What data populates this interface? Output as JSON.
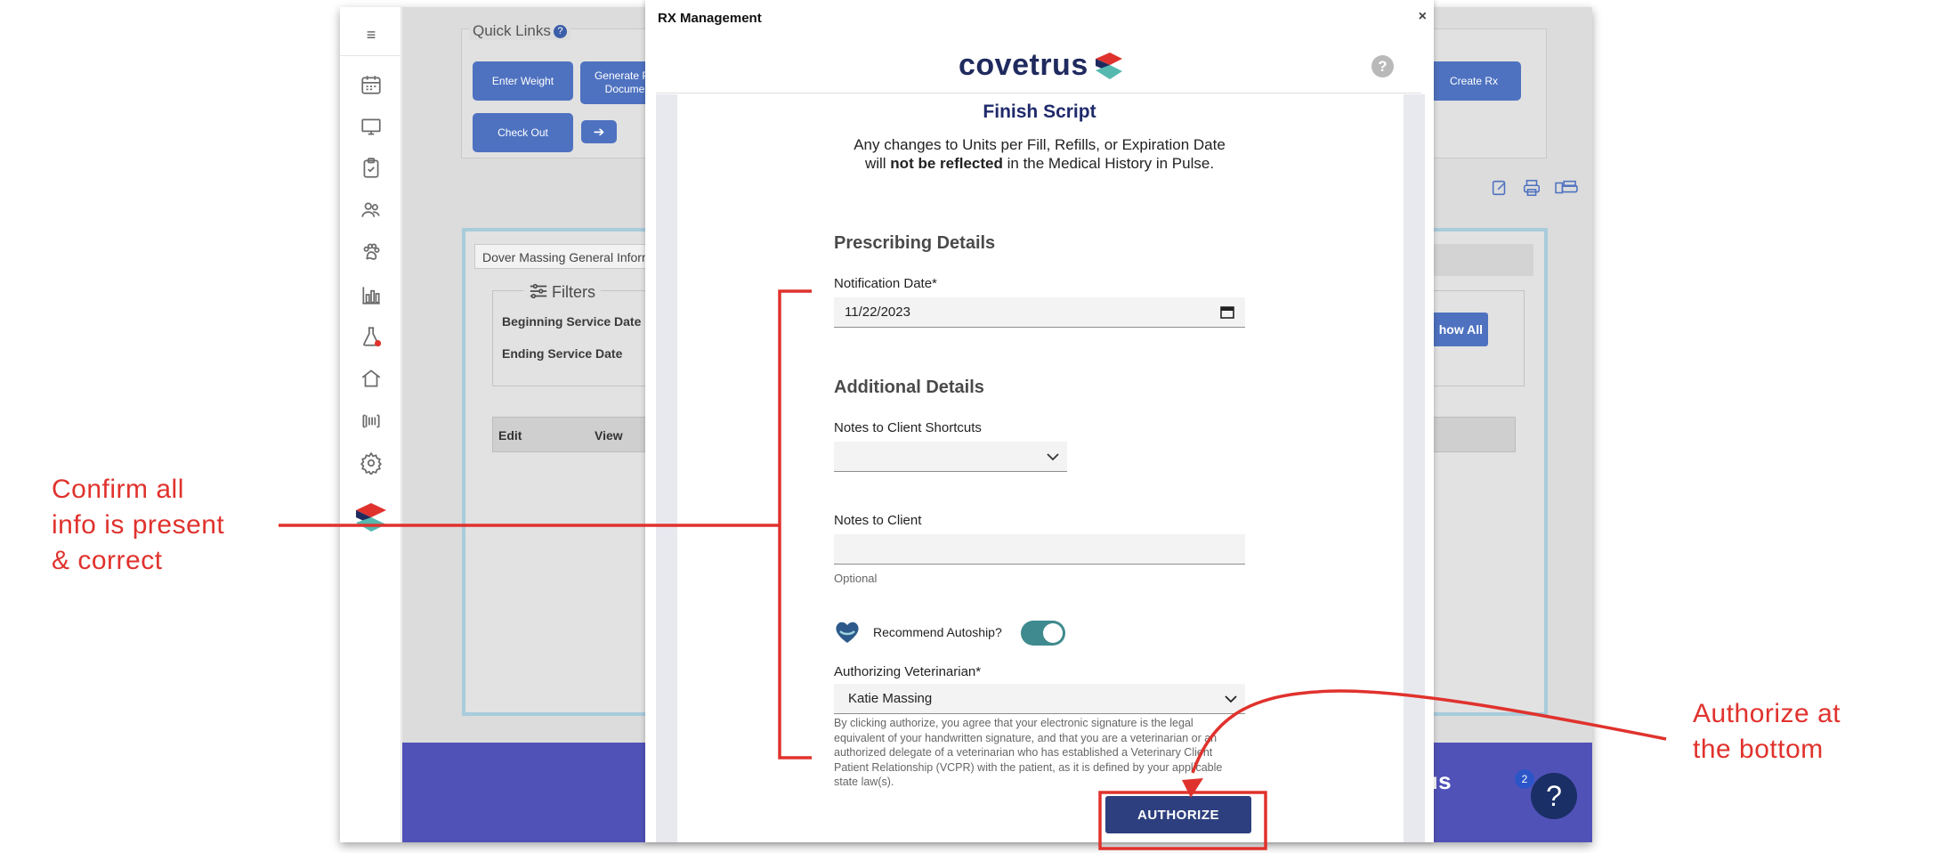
{
  "app": {
    "quick_links": {
      "title": "Quick Links",
      "buttons": {
        "enter_weight": "Enter Weight",
        "generate_docs_line1": "Generate Pa",
        "generate_docs_line2": "Docume",
        "check_out": "Check Out",
        "create_rx": "Create Rx"
      }
    },
    "panel": {
      "tab_label": "Dover Massing General Inform",
      "filters_title": "Filters",
      "beginning_service_date": "Beginning Service Date",
      "ending_service_date": "Ending Service Date",
      "show_all": "how All",
      "columns": [
        "Edit",
        "View"
      ]
    },
    "footer": {
      "logo_text": "vetrus",
      "badge_count": "2",
      "help_symbol": "?"
    },
    "rail_icons": [
      "menu-icon",
      "calendar-icon",
      "monitor-icon",
      "clipboard-icon",
      "people-icon",
      "paw-icon",
      "bar-chart-icon",
      "flask-icon",
      "home-icon",
      "barcode-icon",
      "gear-icon",
      "covetrus-logo-icon"
    ]
  },
  "modal": {
    "title": "RX Management",
    "close_symbol": "×",
    "brand": "covetrus",
    "help_symbol": "?",
    "heading": "Finish Script",
    "warning": {
      "prefix": "Any changes to Units per Fill, Refills, or Expiration Date will ",
      "bold": "not be reflected",
      "suffix": " in the Medical History in Pulse."
    },
    "prescribing_details": {
      "heading": "Prescribing Details",
      "notification_date_label": "Notification Date*",
      "notification_date_value": "11/22/2023"
    },
    "additional_details": {
      "heading": "Additional Details",
      "notes_shortcuts_label": "Notes to Client Shortcuts",
      "notes_shortcuts_value": "",
      "notes_label": "Notes to Client",
      "notes_value": "",
      "notes_hint": "Optional",
      "autoship_label": "Recommend Autoship?",
      "autoship_on": true,
      "vet_label": "Authorizing Veterinarian*",
      "vet_value": "Katie Massing",
      "disclaimer": "By clicking authorize, you agree that your electronic signature is the legal equivalent of your handwritten signature, and that you are a veterinarian or an authorized delegate of a veterinarian who has established a Veterinary Client Patient Relationship (VCPR) with the patient, as it is defined by your applicable state law(s)."
    },
    "authorize_button": "AUTHORIZE"
  },
  "annotations": {
    "left": {
      "line1": "Confirm all",
      "line2": "info is present",
      "line3": "& correct"
    },
    "right": {
      "line1": "Authorize at",
      "line2": "the bottom"
    },
    "color": "#e0322d"
  },
  "colors": {
    "accent_blue": "#4e72c0",
    "brand_navy": "#1f2a5e",
    "authorize_button": "#2e3f7f",
    "toggle_on": "#3f8a8e",
    "footer_purple": "#5152b8"
  }
}
